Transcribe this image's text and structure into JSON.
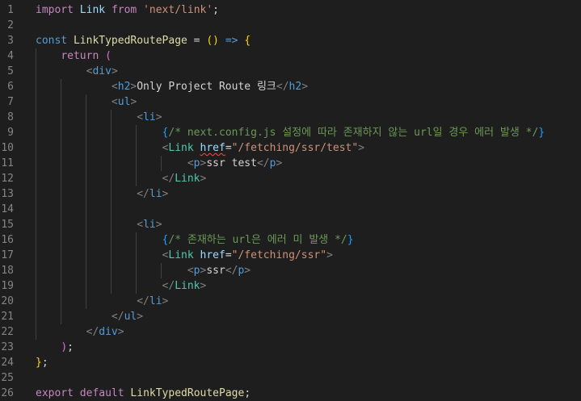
{
  "editor": {
    "language": "javascript-jsx",
    "lines": [
      {
        "n": "1",
        "tokens": [
          [
            "kw",
            "import"
          ],
          [
            "punc",
            " "
          ],
          [
            "var",
            "Link"
          ],
          [
            "punc",
            " "
          ],
          [
            "kw",
            "from"
          ],
          [
            "punc",
            " "
          ],
          [
            "str",
            "'next/link'"
          ],
          [
            "punc",
            ";"
          ]
        ]
      },
      {
        "n": "2",
        "tokens": []
      },
      {
        "n": "3",
        "tokens": [
          [
            "kw2",
            "const"
          ],
          [
            "punc",
            " "
          ],
          [
            "fn",
            "LinkTypedRoutePage"
          ],
          [
            "punc",
            " = "
          ],
          [
            "brace1",
            "()"
          ],
          [
            "punc",
            " "
          ],
          [
            "kw2",
            "=>"
          ],
          [
            "punc",
            " "
          ],
          [
            "brace1",
            "{"
          ]
        ]
      },
      {
        "n": "4",
        "tokens": [
          [
            "punc",
            "    "
          ],
          [
            "kw",
            "return"
          ],
          [
            "punc",
            " "
          ],
          [
            "brace2",
            "("
          ]
        ]
      },
      {
        "n": "5",
        "tokens": [
          [
            "punc",
            "        "
          ],
          [
            "tagp",
            "<"
          ],
          [
            "tag",
            "div"
          ],
          [
            "tagp",
            ">"
          ]
        ]
      },
      {
        "n": "6",
        "tokens": [
          [
            "punc",
            "            "
          ],
          [
            "tagp",
            "<"
          ],
          [
            "tag",
            "h2"
          ],
          [
            "tagp",
            ">"
          ],
          [
            "punc",
            "Only Project Route 링크"
          ],
          [
            "tagp",
            "</"
          ],
          [
            "tag",
            "h2"
          ],
          [
            "tagp",
            ">"
          ]
        ]
      },
      {
        "n": "7",
        "tokens": [
          [
            "punc",
            "            "
          ],
          [
            "tagp",
            "<"
          ],
          [
            "tag",
            "ul"
          ],
          [
            "tagp",
            ">"
          ]
        ]
      },
      {
        "n": "8",
        "tokens": [
          [
            "punc",
            "                "
          ],
          [
            "tagp",
            "<"
          ],
          [
            "tag",
            "li"
          ],
          [
            "tagp",
            ">"
          ]
        ]
      },
      {
        "n": "9",
        "tokens": [
          [
            "punc",
            "                    "
          ],
          [
            "brace3",
            "{"
          ],
          [
            "cmt",
            "/* next.config.js 설정에 따라 존재하지 않는 url일 경우 에러 발생 */"
          ],
          [
            "brace3",
            "}"
          ]
        ]
      },
      {
        "n": "10",
        "tokens": [
          [
            "punc",
            "                    "
          ],
          [
            "tagp",
            "<"
          ],
          [
            "comp",
            "Link"
          ],
          [
            "punc",
            " "
          ],
          [
            "attr squig",
            "href"
          ],
          [
            "punc",
            "="
          ],
          [
            "str",
            "\"/fetching/ssr/test\""
          ],
          [
            "tagp",
            ">"
          ]
        ]
      },
      {
        "n": "11",
        "tokens": [
          [
            "punc",
            "                        "
          ],
          [
            "tagp",
            "<"
          ],
          [
            "tag",
            "p"
          ],
          [
            "tagp",
            ">"
          ],
          [
            "punc",
            "ssr test"
          ],
          [
            "tagp",
            "</"
          ],
          [
            "tag",
            "p"
          ],
          [
            "tagp",
            ">"
          ]
        ]
      },
      {
        "n": "12",
        "tokens": [
          [
            "punc",
            "                    "
          ],
          [
            "tagp",
            "</"
          ],
          [
            "comp",
            "Link"
          ],
          [
            "tagp",
            ">"
          ]
        ]
      },
      {
        "n": "13",
        "tokens": [
          [
            "punc",
            "                "
          ],
          [
            "tagp",
            "</"
          ],
          [
            "tag",
            "li"
          ],
          [
            "tagp",
            ">"
          ]
        ]
      },
      {
        "n": "14",
        "tokens": []
      },
      {
        "n": "15",
        "tokens": [
          [
            "punc",
            "                "
          ],
          [
            "tagp",
            "<"
          ],
          [
            "tag",
            "li"
          ],
          [
            "tagp",
            ">"
          ]
        ]
      },
      {
        "n": "16",
        "tokens": [
          [
            "punc",
            "                    "
          ],
          [
            "brace3",
            "{"
          ],
          [
            "cmt",
            "/* 존재하는 url은 에러 미 발생 */"
          ],
          [
            "brace3",
            "}"
          ]
        ]
      },
      {
        "n": "17",
        "tokens": [
          [
            "punc",
            "                    "
          ],
          [
            "tagp",
            "<"
          ],
          [
            "comp",
            "Link"
          ],
          [
            "punc",
            " "
          ],
          [
            "attr",
            "href"
          ],
          [
            "punc",
            "="
          ],
          [
            "str",
            "\"/fetching/ssr\""
          ],
          [
            "tagp",
            ">"
          ]
        ]
      },
      {
        "n": "18",
        "tokens": [
          [
            "punc",
            "                        "
          ],
          [
            "tagp",
            "<"
          ],
          [
            "tag",
            "p"
          ],
          [
            "tagp",
            ">"
          ],
          [
            "punc",
            "ssr"
          ],
          [
            "tagp",
            "</"
          ],
          [
            "tag",
            "p"
          ],
          [
            "tagp",
            ">"
          ]
        ]
      },
      {
        "n": "19",
        "tokens": [
          [
            "punc",
            "                    "
          ],
          [
            "tagp",
            "</"
          ],
          [
            "comp",
            "Link"
          ],
          [
            "tagp",
            ">"
          ]
        ]
      },
      {
        "n": "20",
        "tokens": [
          [
            "punc",
            "                "
          ],
          [
            "tagp",
            "</"
          ],
          [
            "tag",
            "li"
          ],
          [
            "tagp",
            ">"
          ]
        ]
      },
      {
        "n": "21",
        "tokens": [
          [
            "punc",
            "            "
          ],
          [
            "tagp",
            "</"
          ],
          [
            "tag",
            "ul"
          ],
          [
            "tagp",
            ">"
          ]
        ]
      },
      {
        "n": "22",
        "tokens": [
          [
            "punc",
            "        "
          ],
          [
            "tagp",
            "</"
          ],
          [
            "tag",
            "div"
          ],
          [
            "tagp",
            ">"
          ]
        ]
      },
      {
        "n": "23",
        "tokens": [
          [
            "punc",
            "    "
          ],
          [
            "brace2",
            ")"
          ],
          [
            "punc",
            ";"
          ]
        ]
      },
      {
        "n": "24",
        "tokens": [
          [
            "brace1",
            "}"
          ],
          [
            "punc",
            ";"
          ]
        ]
      },
      {
        "n": "25",
        "tokens": []
      },
      {
        "n": "26",
        "tokens": [
          [
            "kw",
            "export"
          ],
          [
            "punc",
            " "
          ],
          [
            "kw",
            "default"
          ],
          [
            "punc",
            " "
          ],
          [
            "fn",
            "LinkTypedRoutePage"
          ],
          [
            "punc",
            ";"
          ]
        ]
      }
    ]
  }
}
